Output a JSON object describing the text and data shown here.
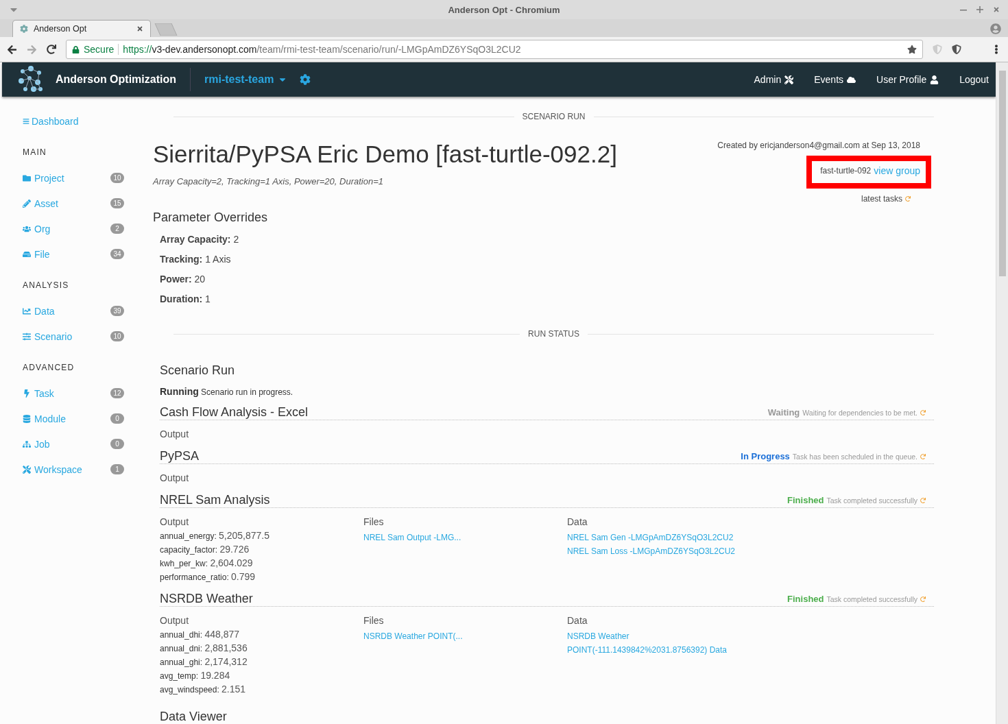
{
  "window": {
    "title": "Anderson Opt - Chromium"
  },
  "tabs": [
    {
      "label": "Anderson Opt",
      "selected": true
    }
  ],
  "address_bar": {
    "secure_label": "Secure",
    "scheme": "https://",
    "host": "v3-dev.andersonopt.com",
    "path": "/team/rmi-test-team/scenario/run/-LMGpAmDZ6YSqO3L2CU2"
  },
  "navbar": {
    "brand": "Anderson Optimization",
    "team": "rmi-test-team",
    "links": [
      {
        "label": "Admin",
        "kind": "tools"
      },
      {
        "label": "Events",
        "kind": "cloud"
      },
      {
        "label": "User Profile",
        "kind": "user"
      },
      {
        "label": "Logout",
        "kind": "none"
      }
    ]
  },
  "sidebar": {
    "dashboard": "Dashboard",
    "groups": [
      {
        "heading": "MAIN",
        "items": [
          {
            "label": "Project",
            "count": "10",
            "kind": "folder"
          },
          {
            "label": "Asset",
            "count": "15",
            "kind": "pencil"
          },
          {
            "label": "Org",
            "count": "2",
            "kind": "users"
          },
          {
            "label": "File",
            "count": "34",
            "kind": "drive"
          }
        ]
      },
      {
        "heading": "ANALYSIS",
        "items": [
          {
            "label": "Data",
            "count": "39",
            "kind": "chart"
          },
          {
            "label": "Scenario",
            "count": "10",
            "kind": "sliders"
          }
        ]
      },
      {
        "heading": "ADVANCED",
        "items": [
          {
            "label": "Task",
            "count": "12",
            "kind": "bolt"
          },
          {
            "label": "Module",
            "count": "0",
            "kind": "database"
          },
          {
            "label": "Job",
            "count": "0",
            "kind": "sitemap"
          },
          {
            "label": "Workspace",
            "count": "1",
            "kind": "tools"
          }
        ]
      }
    ]
  },
  "scenario_divider": "SCENARIO RUN",
  "title": "Sierrita/PyPSA Eric Demo [fast-turtle-092.2]",
  "subtitle": "Array Capacity=2, Tracking=1 Axis, Power=20, Duration=1",
  "meta": {
    "created": "Created by ericjanderson4@gmail.com at Sep 13, 2018",
    "group": "fast-turtle-092",
    "group_link": "view group",
    "latest_tasks": "latest tasks",
    "highlighted": true
  },
  "overrides_heading": "Parameter Overrides",
  "overrides": [
    {
      "name": "Array Capacity:",
      "value": "2"
    },
    {
      "name": "Tracking:",
      "value": "1 Axis"
    },
    {
      "name": "Power:",
      "value": "20"
    },
    {
      "name": "Duration:",
      "value": "1"
    }
  ],
  "run_status_divider": "RUN STATUS",
  "scenario_run": {
    "heading": "Scenario Run",
    "status": "Running",
    "message": "Scenario run in progress."
  },
  "tasks": [
    {
      "name": "Cash Flow Analysis - Excel",
      "status": "Waiting",
      "kind": "waiting",
      "message": "Waiting for dependencies to be met.",
      "output_label": "Output"
    },
    {
      "name": "PyPSA",
      "status": "In Progress",
      "kind": "in_progress",
      "message": "Task has been scheduled in the queue.",
      "output_label": "Output"
    },
    {
      "name": "NREL Sam Analysis",
      "status": "Finished",
      "kind": "finished",
      "message": "Task completed successfully",
      "output_label": "Output",
      "outputs": [
        {
          "key": "annual_energy:",
          "value": "5,205,877.5"
        },
        {
          "key": "capacity_factor:",
          "value": "29.726"
        },
        {
          "key": "kwh_per_kw:",
          "value": "2,604.029"
        },
        {
          "key": "performance_ratio:",
          "value": "0.799"
        }
      ],
      "files_label": "Files",
      "files": [
        "NREL Sam Output -LMG..."
      ],
      "data_label": "Data",
      "data": [
        "NREL Sam Gen -LMGpAmDZ6YSqO3L2CU2",
        "NREL Sam Loss -LMGpAmDZ6YSqO3L2CU2"
      ]
    },
    {
      "name": "NSRDB Weather",
      "status": "Finished",
      "kind": "finished",
      "message": "Task completed successfully",
      "output_label": "Output",
      "outputs": [
        {
          "key": "annual_dhi:",
          "value": "448,877"
        },
        {
          "key": "annual_dni:",
          "value": "2,881,536"
        },
        {
          "key": "annual_ghi:",
          "value": "2,174,312"
        },
        {
          "key": "avg_temp:",
          "value": "19.284"
        },
        {
          "key": "avg_windspeed:",
          "value": "2.151"
        }
      ],
      "files_label": "Files",
      "files": [
        "NSRDB Weather POINT(..."
      ],
      "data_label": "Data",
      "data": [
        "NSRDB Weather",
        "POINT(-111.1439842%2031.8756392) Data"
      ]
    }
  ],
  "data_viewer": "Data Viewer"
}
